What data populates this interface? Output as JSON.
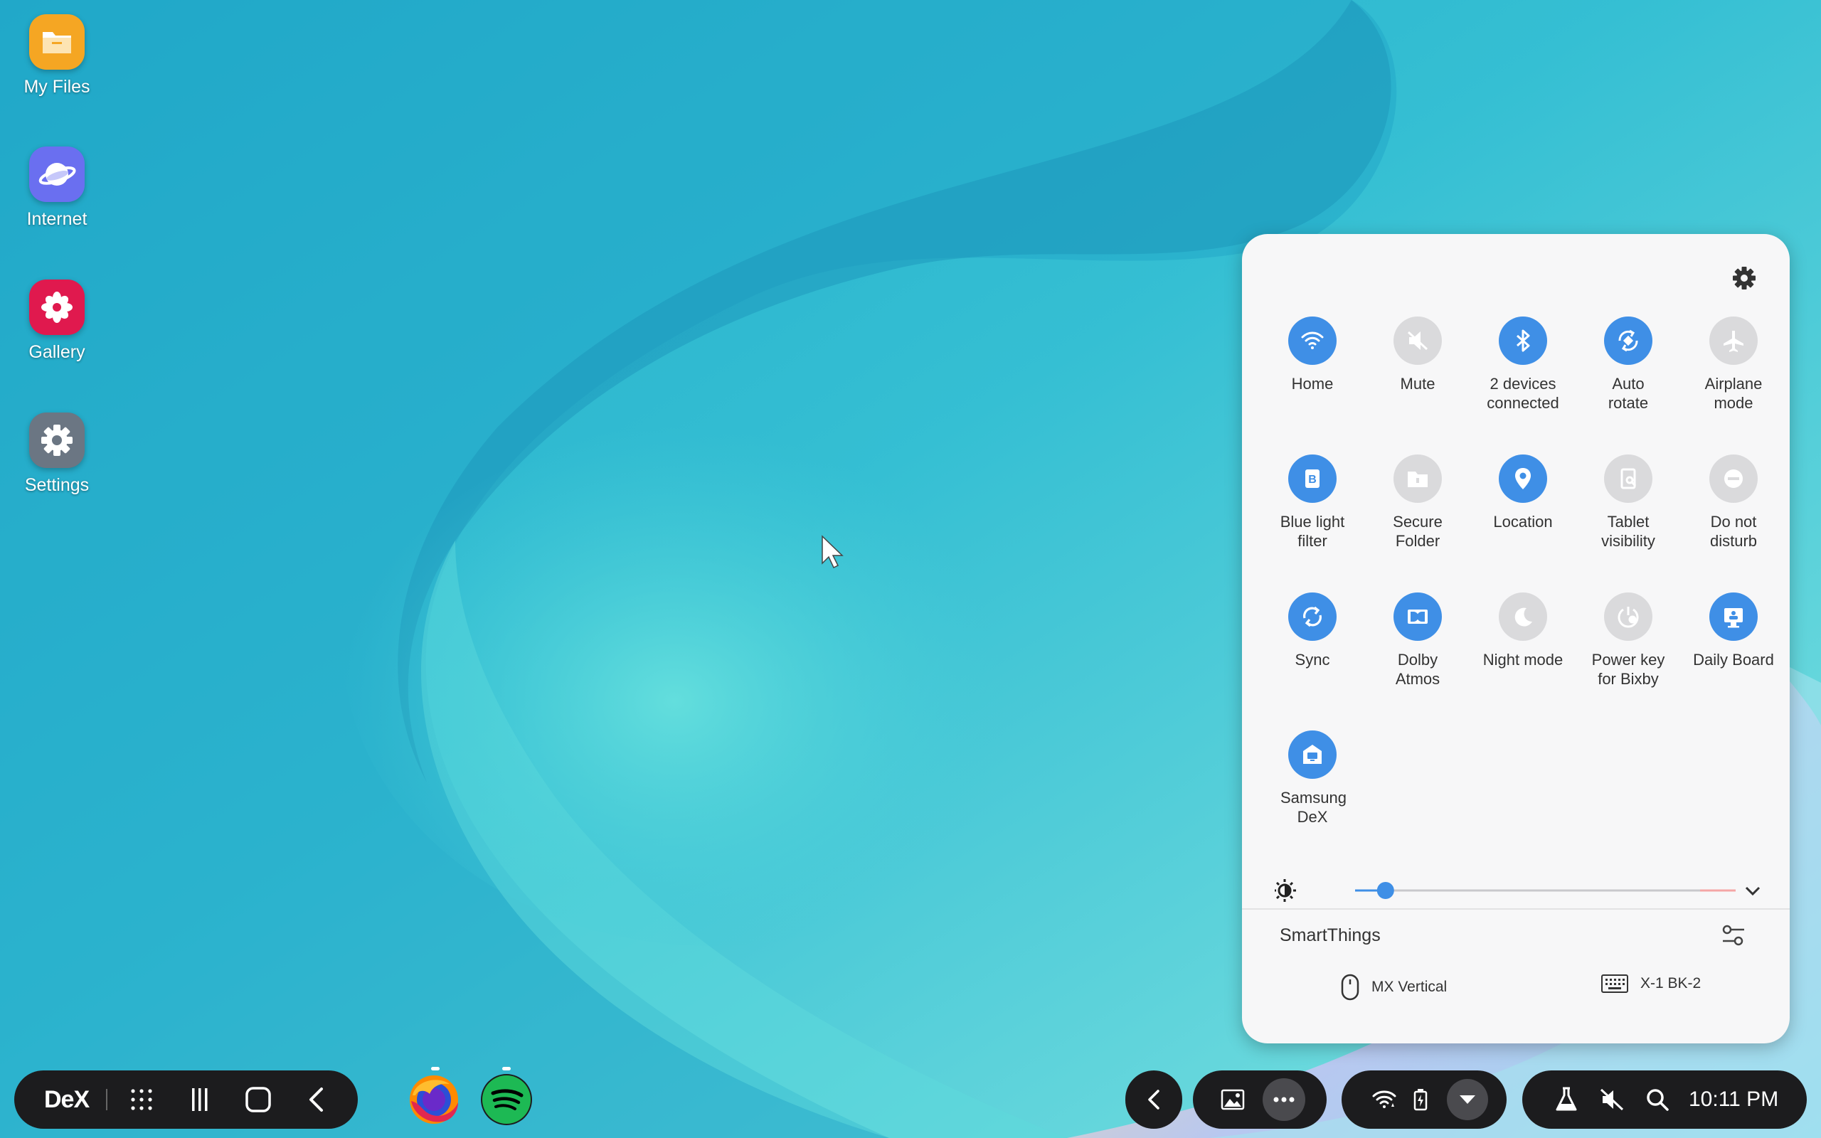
{
  "desktop": {
    "icons": [
      {
        "label": "My Files",
        "icon": "folder-icon",
        "color": "#f5a623"
      },
      {
        "label": "Internet",
        "icon": "planet-icon",
        "color": "#6a6ff0"
      },
      {
        "label": "Gallery",
        "icon": "flower-icon",
        "color": "#e0194e"
      },
      {
        "label": "Settings",
        "icon": "gear-icon",
        "color": "#6b7683"
      }
    ]
  },
  "quick_panel": {
    "tiles": [
      {
        "label": "Home",
        "icon": "wifi-icon",
        "state": "on"
      },
      {
        "label": "Mute",
        "icon": "mute-icon",
        "state": "off"
      },
      {
        "label": "2 devices connected",
        "icon": "bluetooth-icon",
        "state": "on"
      },
      {
        "label": "Auto rotate",
        "icon": "auto-rotate-icon",
        "state": "on"
      },
      {
        "label": "Airplane mode",
        "icon": "airplane-icon",
        "state": "off"
      },
      {
        "label": "Blue light filter",
        "icon": "blue-light-icon",
        "state": "on"
      },
      {
        "label": "Secure Folder",
        "icon": "secure-folder-icon",
        "state": "off"
      },
      {
        "label": "Location",
        "icon": "location-pin-icon",
        "state": "on"
      },
      {
        "label": "Tablet visibility",
        "icon": "tablet-visibility-icon",
        "state": "off"
      },
      {
        "label": "Do not disturb",
        "icon": "do-not-disturb-icon",
        "state": "off"
      },
      {
        "label": "Sync",
        "icon": "sync-icon",
        "state": "on"
      },
      {
        "label": "Dolby Atmos",
        "icon": "dolby-icon",
        "state": "on"
      },
      {
        "label": "Night mode",
        "icon": "moon-icon",
        "state": "off"
      },
      {
        "label": "Power key for Bixby",
        "icon": "bixby-icon",
        "state": "off"
      },
      {
        "label": "Daily Board",
        "icon": "daily-board-icon",
        "state": "on"
      },
      {
        "label": "Samsung DeX",
        "icon": "dex-icon",
        "state": "on"
      }
    ],
    "brightness_level": 0.08,
    "smartthings": {
      "title": "SmartThings",
      "devices": [
        {
          "name": "MX Vertical",
          "icon": "mouse-icon"
        },
        {
          "name": "X-1 BK-2",
          "icon": "keyboard-icon"
        }
      ]
    }
  },
  "taskbar": {
    "dex_label": "DeX",
    "pinned_apps": [
      "firefox-icon",
      "spotify-icon"
    ],
    "clock": "10:11 PM"
  },
  "colors": {
    "accent": "#3f8fe6",
    "tile_off": "#dadadc",
    "panel_bg": "#f7f7f8",
    "taskbar_bg": "#1c1c1e",
    "spotify": "#1db954"
  }
}
